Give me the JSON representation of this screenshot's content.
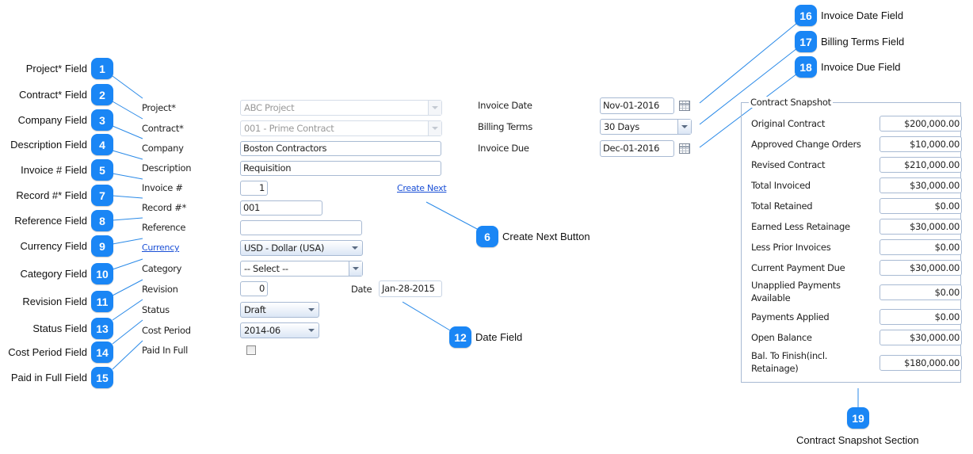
{
  "callouts": [
    {
      "num": "1",
      "text": "Project* Field"
    },
    {
      "num": "2",
      "text": "Contract* Field"
    },
    {
      "num": "3",
      "text": "Company Field"
    },
    {
      "num": "4",
      "text": "Description Field"
    },
    {
      "num": "5",
      "text": "Invoice # Field"
    },
    {
      "num": "6",
      "text": "Create Next Button"
    },
    {
      "num": "7",
      "text": "Record #* Field"
    },
    {
      "num": "8",
      "text": "Reference Field"
    },
    {
      "num": "9",
      "text": "Currency Field"
    },
    {
      "num": "10",
      "text": "Category Field"
    },
    {
      "num": "11",
      "text": "Revision Field"
    },
    {
      "num": "12",
      "text": "Date Field"
    },
    {
      "num": "13",
      "text": "Status Field"
    },
    {
      "num": "14",
      "text": "Cost Period Field"
    },
    {
      "num": "15",
      "text": "Paid in Full Field"
    },
    {
      "num": "16",
      "text": "Invoice Date Field"
    },
    {
      "num": "17",
      "text": "Billing Terms Field"
    },
    {
      "num": "18",
      "text": "Invoice Due Field"
    },
    {
      "num": "19",
      "text": "Contract Snapshot Section"
    }
  ],
  "form": {
    "project": {
      "label": "Project*",
      "value": "ABC Project"
    },
    "contract": {
      "label": "Contract*",
      "value": "001 - Prime Contract"
    },
    "company": {
      "label": "Company",
      "value": "Boston Contractors"
    },
    "description": {
      "label": "Description",
      "value": "Requisition"
    },
    "invoice_no": {
      "label": "Invoice #",
      "value": "1"
    },
    "create_next": "Create Next",
    "record_no": {
      "label": "Record #*",
      "value": "001"
    },
    "reference": {
      "label": "Reference",
      "value": ""
    },
    "currency": {
      "label": "Currency",
      "value": "USD - Dollar (USA)"
    },
    "category": {
      "label": "Category",
      "value": "-- Select --"
    },
    "revision": {
      "label": "Revision",
      "value": "0"
    },
    "date": {
      "label": "Date",
      "value": "Jan-28-2015"
    },
    "status": {
      "label": "Status",
      "value": "Draft"
    },
    "cost_period": {
      "label": "Cost Period",
      "value": "2014-06"
    },
    "paid_in_full": {
      "label": "Paid In Full",
      "checked": false
    },
    "invoice_date": {
      "label": "Invoice Date",
      "value": "Nov-01-2016"
    },
    "billing_terms": {
      "label": "Billing Terms",
      "value": "30 Days"
    },
    "invoice_due": {
      "label": "Invoice Due",
      "value": "Dec-01-2016"
    }
  },
  "snapshot": {
    "title": "Contract Snapshot",
    "rows": [
      {
        "label": "Original Contract",
        "value": "$200,000.00"
      },
      {
        "label": "Approved Change Orders",
        "value": "$10,000.00"
      },
      {
        "label": "Revised Contract",
        "value": "$210,000.00"
      },
      {
        "label": "Total Invoiced",
        "value": "$30,000.00"
      },
      {
        "label": "Total Retained",
        "value": "$0.00"
      },
      {
        "label": "Earned Less Retainage",
        "value": "$30,000.00"
      },
      {
        "label": "Less Prior Invoices",
        "value": "$0.00"
      },
      {
        "label": "Current Payment Due",
        "value": "$30,000.00"
      },
      {
        "label": "Unapplied Payments Available",
        "value": "$0.00"
      },
      {
        "label": "Payments Applied",
        "value": "$0.00"
      },
      {
        "label": "Open Balance",
        "value": "$30,000.00"
      },
      {
        "label": "Bal. To Finish(incl. Retainage)",
        "value": "$180,000.00"
      }
    ]
  },
  "colors": {
    "callout_badge": "#1a86f5",
    "leader_line": "#2a8ae8",
    "link": "#1a4fd6"
  }
}
